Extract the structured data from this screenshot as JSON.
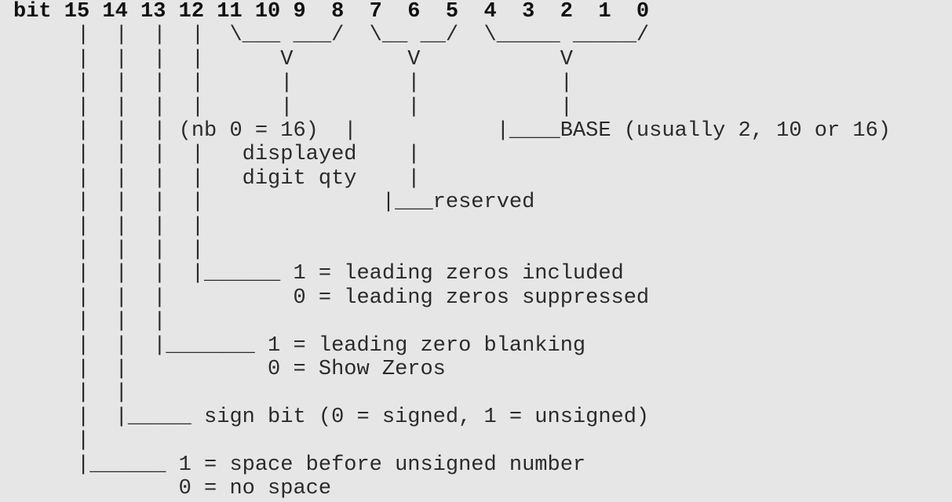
{
  "diagram": {
    "title_row": "bit 15 14 13 12 11 10 9  8  7  6  5  4  3  2  1  0",
    "lines": [
      "     |  |  |  |  \\___ ___/  \\__ __/  \\_____ _____/",
      "     |  |  |  |      V         V           V",
      "     |  |  |  |      |         |           |",
      "     |  |  |  |      |         |           |",
      "     |  |  | (nb 0 = 16)  |           |____BASE (usually 2, 10 or 16)",
      "     |  |  |  |   displayed    |",
      "     |  |  |  |   digit qty    |",
      "     |  |  |  |              |___reserved",
      "     |  |  |  |",
      "     |  |  |  |",
      "     |  |  |  |______ 1 = leading zeros included",
      "     |  |  |          0 = leading zeros suppressed",
      "     |  |  |",
      "     |  |  |_______ 1 = leading zero blanking",
      "     |  |           0 = Show Zeros",
      "     |  |",
      "     |  |_____ sign bit (0 = signed, 1 = unsigned)",
      "     |",
      "     |______ 1 = space before unsigned number",
      "             0 = no space"
    ],
    "fields": [
      {
        "bits": "15",
        "description": "1 = space before unsigned number",
        "alt": "0 = no space"
      },
      {
        "bits": "14",
        "description": "sign bit (0 = signed, 1 = unsigned)"
      },
      {
        "bits": "13",
        "description": "1 = leading zero blanking",
        "alt": "0 = Show Zeros"
      },
      {
        "bits": "12",
        "description": "1 = leading zeros included",
        "alt": "0 = leading zeros suppressed"
      },
      {
        "bits": "11-8",
        "description": "(nb 0 = 16) displayed digit qty"
      },
      {
        "bits": "7-5",
        "description": "reserved"
      },
      {
        "bits": "4-0",
        "description": "BASE (usually 2, 10 or 16)"
      }
    ]
  }
}
